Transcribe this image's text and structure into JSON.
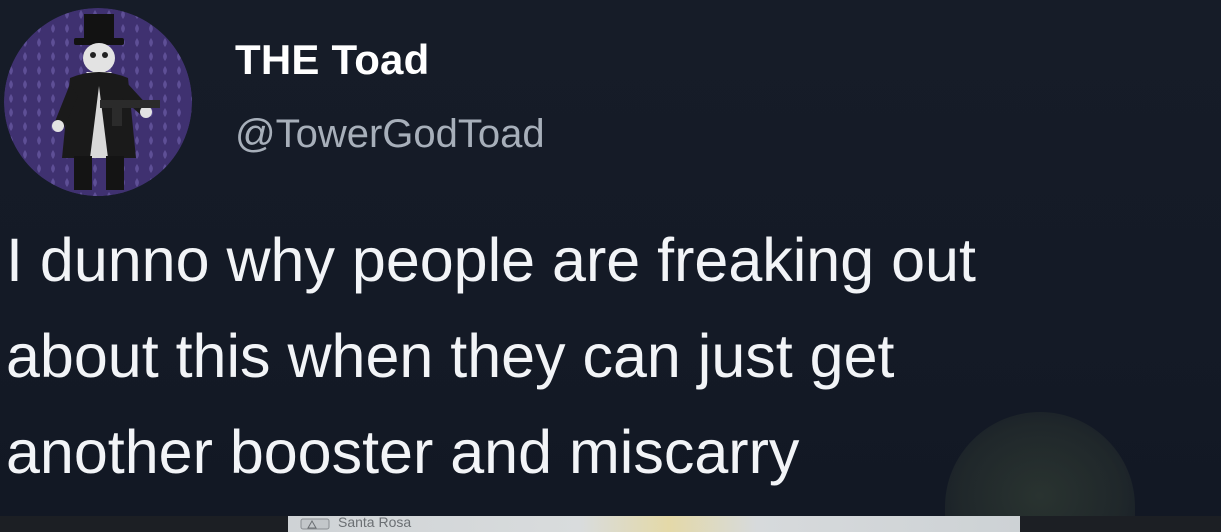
{
  "tweet": {
    "display_name": "THE Toad",
    "handle": "@TowerGodToad",
    "text_lines": [
      "I dunno why people are freaking out",
      "about this when they can just get",
      "another booster and miscarry"
    ]
  },
  "avatar": {
    "icon": "avatar-image",
    "background_color": "#4b3a7a"
  },
  "footer": {
    "map_label": "Santa Rosa"
  },
  "colors": {
    "background": "#141a26",
    "name": "#ffffff",
    "handle": "#a7afba",
    "text": "#f2f4f7"
  }
}
